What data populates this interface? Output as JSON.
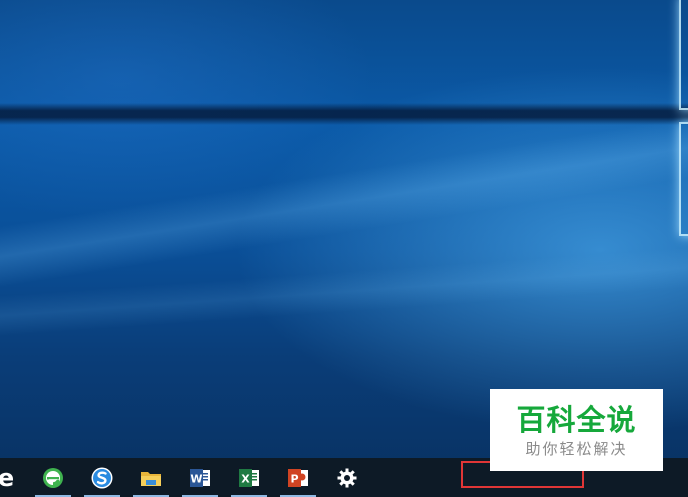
{
  "watermark": {
    "title": "百科全说",
    "subtitle": "助你轻松解决"
  },
  "taskbar": {
    "items": [
      {
        "icon": "ie-icon",
        "active": false
      },
      {
        "icon": "browser-e-icon",
        "active": true
      },
      {
        "icon": "sogou-s-icon",
        "active": true
      },
      {
        "icon": "file-explorer-icon",
        "active": true
      },
      {
        "icon": "word-icon",
        "active": true
      },
      {
        "icon": "excel-icon",
        "active": true
      },
      {
        "icon": "powerpoint-icon",
        "active": true
      },
      {
        "icon": "settings-gear-icon",
        "active": false
      }
    ],
    "tray_highlight_color": "#e03636"
  },
  "colors": {
    "taskbar_bg": "#0d1a26",
    "wallpaper_primary": "#0b5aa8",
    "watermark_text": "#16a83b"
  }
}
